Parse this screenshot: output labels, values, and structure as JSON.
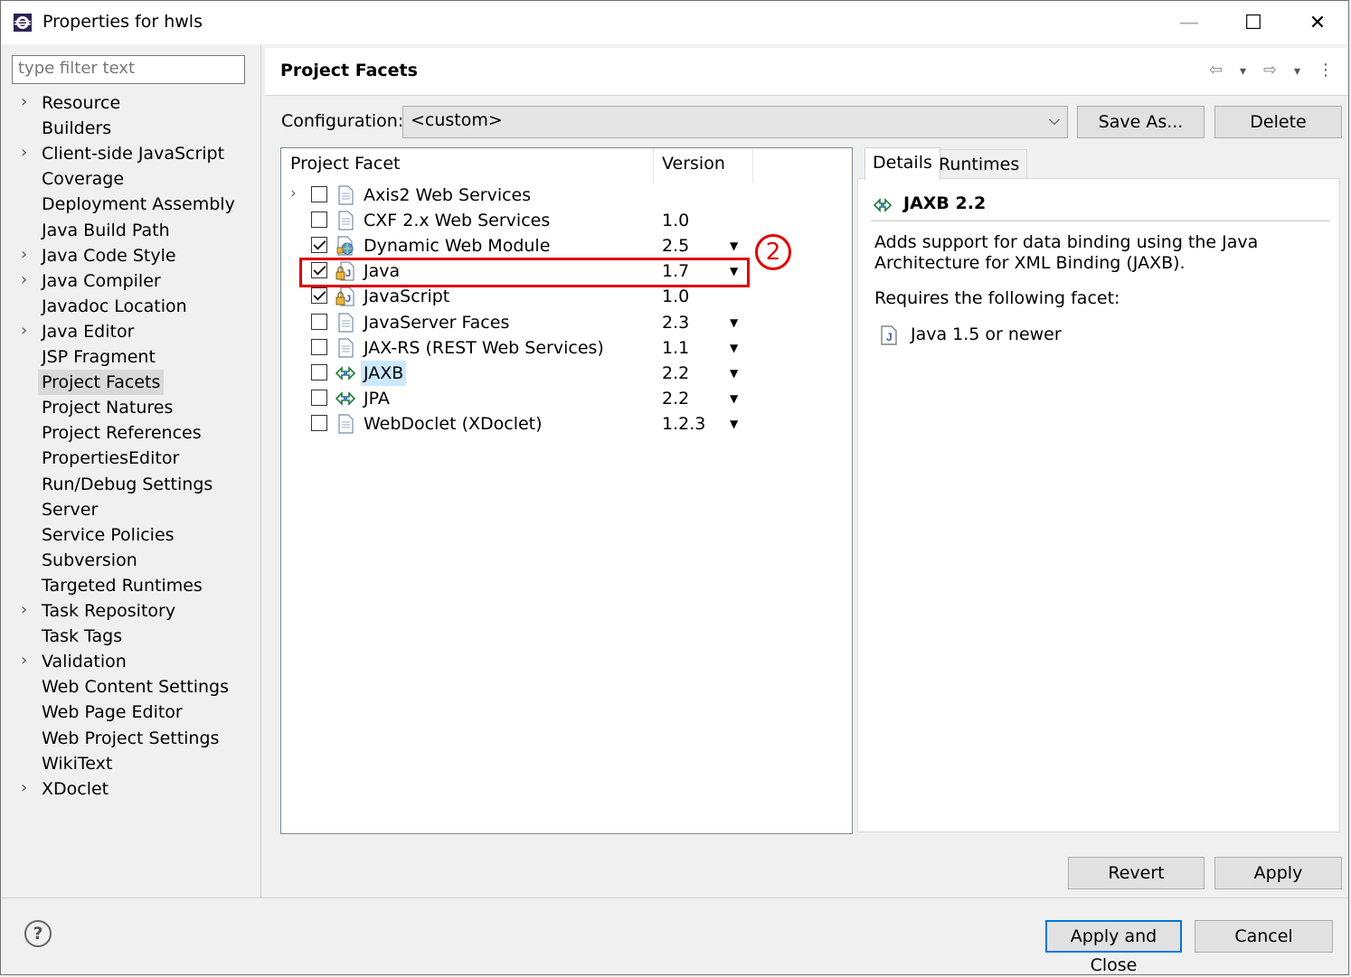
{
  "window": {
    "title": "Properties for hwls",
    "minimize": "—",
    "maximize": "☐",
    "close": "✕"
  },
  "sidebar": {
    "filter_placeholder": "type filter text",
    "items": [
      {
        "label": "Resource",
        "expandable": true
      },
      {
        "label": "Builders",
        "expandable": false
      },
      {
        "label": "Client-side JavaScript",
        "expandable": true
      },
      {
        "label": "Coverage",
        "expandable": false
      },
      {
        "label": "Deployment Assembly",
        "expandable": false
      },
      {
        "label": "Java Build Path",
        "expandable": false
      },
      {
        "label": "Java Code Style",
        "expandable": true
      },
      {
        "label": "Java Compiler",
        "expandable": true
      },
      {
        "label": "Javadoc Location",
        "expandable": false
      },
      {
        "label": "Java Editor",
        "expandable": true
      },
      {
        "label": "JSP Fragment",
        "expandable": false
      },
      {
        "label": "Project Facets",
        "expandable": false,
        "selected": true
      },
      {
        "label": "Project Natures",
        "expandable": false
      },
      {
        "label": "Project References",
        "expandable": false
      },
      {
        "label": "PropertiesEditor",
        "expandable": false
      },
      {
        "label": "Run/Debug Settings",
        "expandable": false
      },
      {
        "label": "Server",
        "expandable": false
      },
      {
        "label": "Service Policies",
        "expandable": false
      },
      {
        "label": "Subversion",
        "expandable": false
      },
      {
        "label": "Targeted Runtimes",
        "expandable": false
      },
      {
        "label": "Task Repository",
        "expandable": true
      },
      {
        "label": "Task Tags",
        "expandable": false
      },
      {
        "label": "Validation",
        "expandable": true
      },
      {
        "label": "Web Content Settings",
        "expandable": false
      },
      {
        "label": "Web Page Editor",
        "expandable": false
      },
      {
        "label": "Web Project Settings",
        "expandable": false
      },
      {
        "label": "WikiText",
        "expandable": false
      },
      {
        "label": "XDoclet",
        "expandable": true
      }
    ]
  },
  "page": {
    "title": "Project Facets",
    "nav_back": "⇦",
    "nav_forward": "⇨",
    "nav_dropdown": "▾",
    "nav_menu": "⋮"
  },
  "configuration": {
    "label": "Configuration:",
    "value": "<custom>",
    "dropdown_arrow": "⌵",
    "save_as": "Save As...",
    "delete": "Delete"
  },
  "facets": {
    "col_facet": "Project Facet",
    "col_version": "Version",
    "rows": [
      {
        "name": "Axis2 Web Services",
        "version": "",
        "checked": false,
        "expand": true,
        "icon": "doc",
        "dropdown": false
      },
      {
        "name": "CXF 2.x Web Services",
        "version": "1.0",
        "checked": false,
        "expand": false,
        "icon": "doc",
        "dropdown": false
      },
      {
        "name": "Dynamic Web Module",
        "version": "2.5",
        "checked": true,
        "expand": false,
        "icon": "web",
        "dropdown": true
      },
      {
        "name": "Java",
        "version": "1.7",
        "checked": true,
        "expand": false,
        "icon": "lock",
        "dropdown": true
      },
      {
        "name": "JavaScript",
        "version": "1.0",
        "checked": true,
        "expand": false,
        "icon": "lock",
        "dropdown": false
      },
      {
        "name": "JavaServer Faces",
        "version": "2.3",
        "checked": false,
        "expand": false,
        "icon": "doc",
        "dropdown": true
      },
      {
        "name": "JAX-RS (REST Web Services)",
        "version": "1.1",
        "checked": false,
        "expand": false,
        "icon": "doc",
        "dropdown": true
      },
      {
        "name": "JAXB",
        "version": "2.2",
        "checked": false,
        "expand": false,
        "icon": "bind",
        "dropdown": true,
        "selected": true
      },
      {
        "name": "JPA",
        "version": "2.2",
        "checked": false,
        "expand": false,
        "icon": "bind",
        "dropdown": true
      },
      {
        "name": "WebDoclet (XDoclet)",
        "version": "1.2.3",
        "checked": false,
        "expand": false,
        "icon": "doc",
        "dropdown": true
      }
    ]
  },
  "annotation": {
    "marker": "2"
  },
  "details": {
    "tab_details": "Details",
    "tab_runtimes": "Runtimes",
    "title": "JAXB 2.2",
    "description_line1": "Adds support for data binding using the Java",
    "description_line2": "Architecture for XML Binding (JAXB).",
    "requires_label": "Requires the following facet:",
    "requirement": "Java 1.5 or newer"
  },
  "buttons": {
    "revert": "Revert",
    "apply": "Apply",
    "apply_and_close": "Apply and Close",
    "cancel": "Cancel",
    "help": "?"
  },
  "colors": {
    "selection": "#cce8ff",
    "annotation": "#e00000",
    "default_button_border": "#0078d7"
  }
}
